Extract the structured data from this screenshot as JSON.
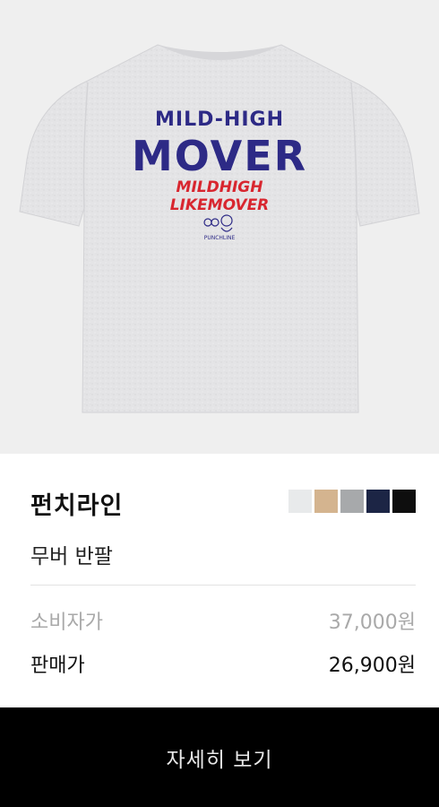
{
  "product_image": {
    "print_top": "MILD-HIGH",
    "print_main": "MOVER",
    "print_sub_1": "MILDHIGH",
    "print_sub_2": "LIKEMOVER",
    "print_small": "PUNCHLINE",
    "shirt_color": "#e3e3e5",
    "print_blue": "#2d2a86",
    "print_red": "#d8262f"
  },
  "brand": "펀치라인",
  "product_name": "무버 반팔",
  "swatches": [
    {
      "name": "light-gray",
      "color": "#e8eaeb"
    },
    {
      "name": "beige",
      "color": "#d4b48f"
    },
    {
      "name": "gray",
      "color": "#a7a9ab"
    },
    {
      "name": "navy",
      "color": "#1c2545"
    },
    {
      "name": "black",
      "color": "#0e0e0e"
    }
  ],
  "pricing": {
    "retail_label": "소비자가",
    "retail_price": "37,000원",
    "sale_label": "판매가",
    "sale_price": "26,900원"
  },
  "cta_label": "자세히 보기"
}
